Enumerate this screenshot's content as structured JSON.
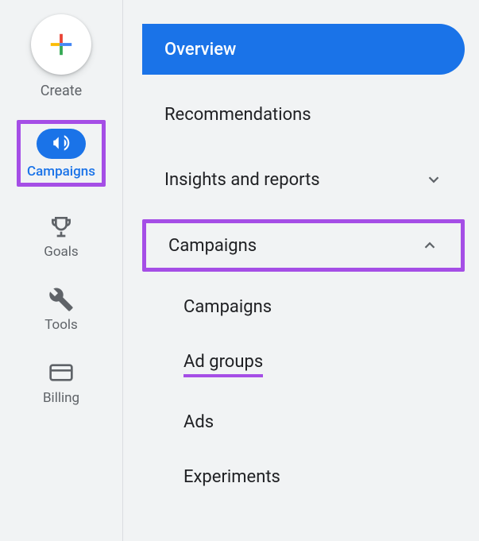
{
  "leftRail": {
    "create": {
      "label": "Create"
    },
    "items": [
      {
        "label": "Campaigns",
        "icon": "megaphone-icon",
        "selected": true
      },
      {
        "label": "Goals",
        "icon": "trophy-icon"
      },
      {
        "label": "Tools",
        "icon": "tools-icon"
      },
      {
        "label": "Billing",
        "icon": "card-icon"
      }
    ]
  },
  "menu": {
    "overview": "Overview",
    "recommendations": "Recommendations",
    "insights": "Insights and reports",
    "campaigns": "Campaigns",
    "sub": {
      "campaigns": "Campaigns",
      "adgroups": "Ad groups",
      "ads": "Ads",
      "experiments": "Experiments"
    }
  }
}
